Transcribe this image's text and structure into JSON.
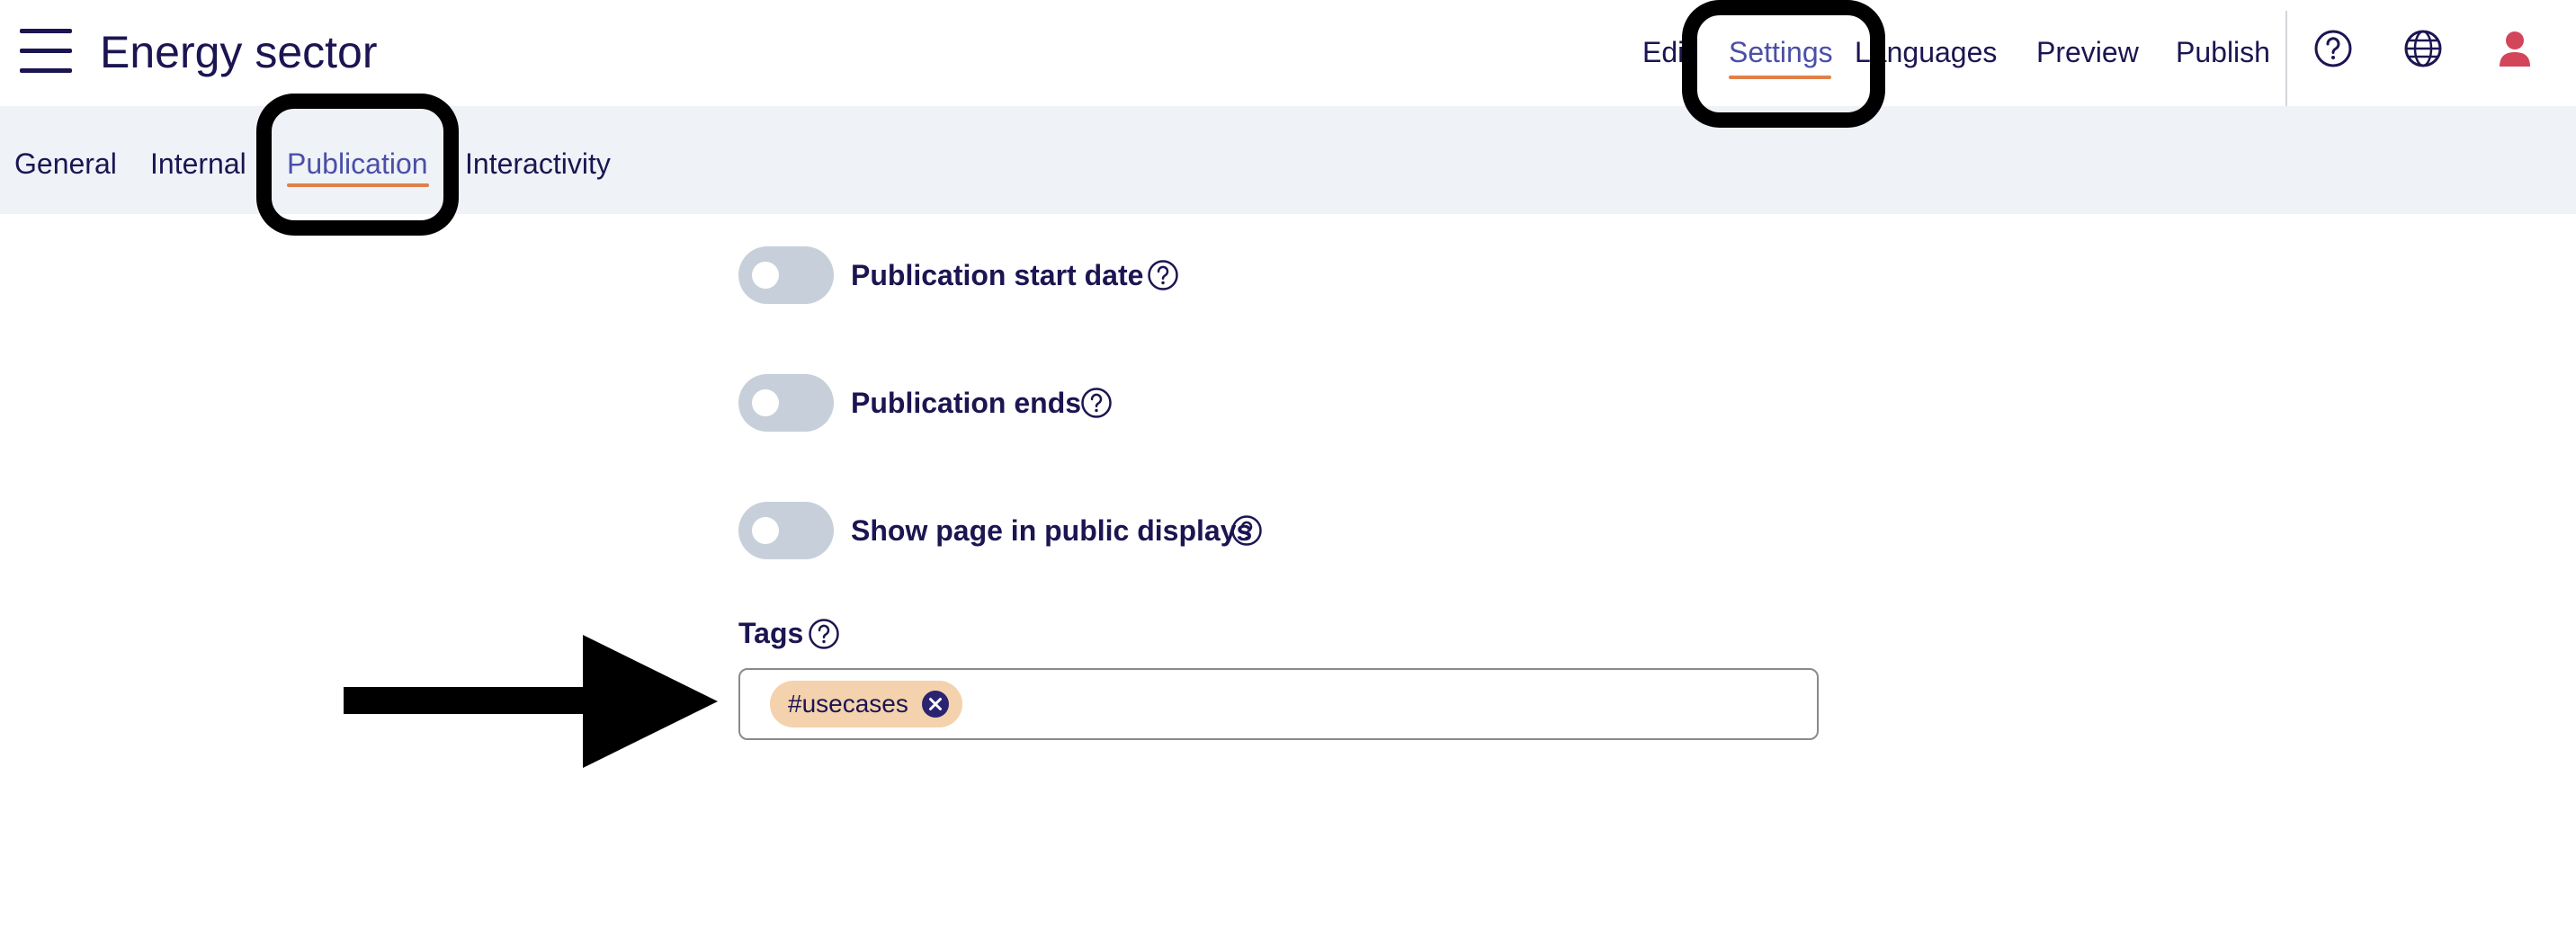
{
  "header": {
    "title": "Energy sector",
    "nav": [
      {
        "label": "Edit"
      },
      {
        "label": "Settings"
      },
      {
        "label": "Languages"
      },
      {
        "label": "Preview"
      },
      {
        "label": "Publish"
      }
    ],
    "icons": [
      "menu-icon",
      "help-circle-icon",
      "globe-icon",
      "user-icon"
    ],
    "active_nav": "Settings"
  },
  "subtabs": [
    {
      "label": "General"
    },
    {
      "label": "Internal"
    },
    {
      "label": "Publication"
    },
    {
      "label": "Interactivity"
    }
  ],
  "active_subtab": "Publication",
  "settings": {
    "toggles": [
      {
        "label": "Publication start date",
        "on": false
      },
      {
        "label": "Publication ends",
        "on": false
      },
      {
        "label": "Show page in public displays",
        "on": false
      }
    ],
    "tags": {
      "label": "Tags",
      "values": [
        "#usecases"
      ]
    }
  },
  "colors": {
    "text": "#1b1552",
    "active": "#4a4fa8",
    "underline": "#e0804a",
    "subtab_bg": "#eff2f7",
    "toggle_off": "#c7d0da",
    "tag_bg": "#f4d2ad",
    "user_icon": "#d3455b"
  }
}
